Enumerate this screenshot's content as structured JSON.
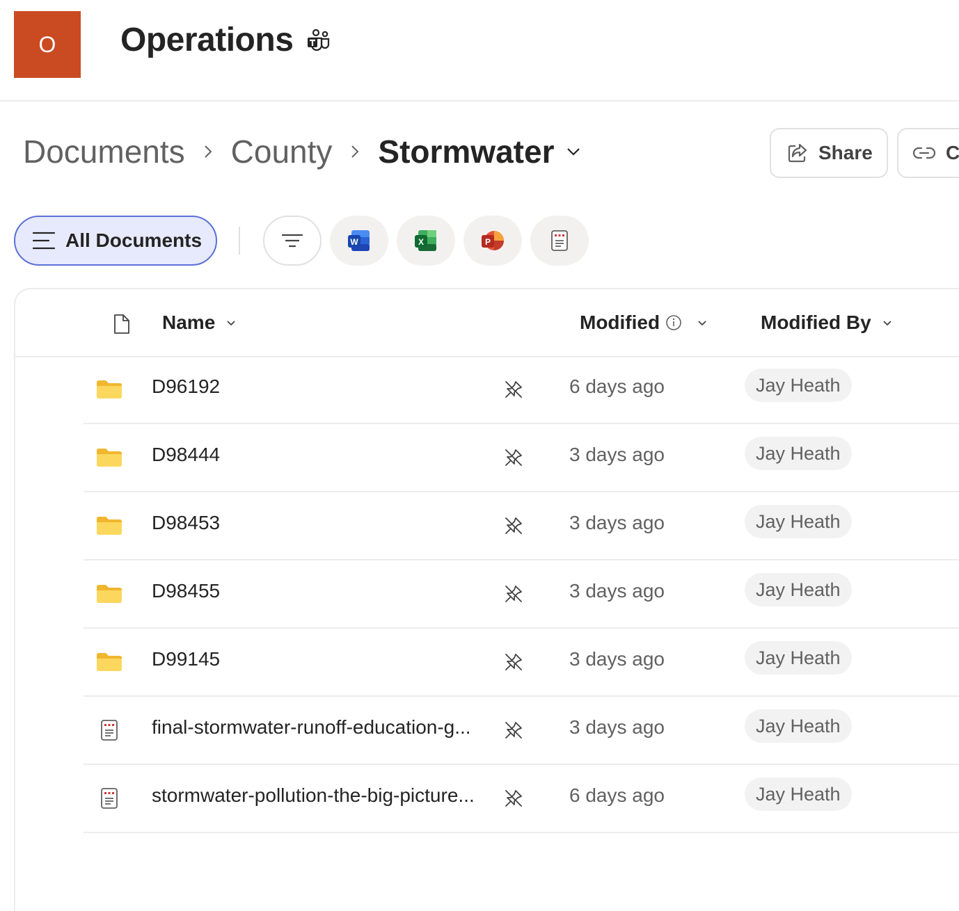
{
  "site": {
    "logo_letter": "O",
    "title": "Operations",
    "logo_color": "#ca4a22"
  },
  "breadcrumb": {
    "items": [
      "Documents",
      "County",
      "Stormwater"
    ]
  },
  "actions": {
    "share_label": "Share",
    "copy_label": "Co"
  },
  "filters": {
    "view_label": "All Documents",
    "chips": [
      "filter-icon",
      "word-icon",
      "excel-icon",
      "powerpoint-icon",
      "pdf-icon"
    ]
  },
  "list": {
    "columns": {
      "name": "Name",
      "modified": "Modified",
      "modified_by": "Modified By"
    },
    "rows": [
      {
        "type": "folder",
        "name": "D96192",
        "modified": "6 days ago",
        "modified_by": "Jay Heath"
      },
      {
        "type": "folder",
        "name": "D98444",
        "modified": "3 days ago",
        "modified_by": "Jay Heath"
      },
      {
        "type": "folder",
        "name": "D98453",
        "modified": "3 days ago",
        "modified_by": "Jay Heath"
      },
      {
        "type": "folder",
        "name": "D98455",
        "modified": "3 days ago",
        "modified_by": "Jay Heath"
      },
      {
        "type": "folder",
        "name": "D99145",
        "modified": "3 days ago",
        "modified_by": "Jay Heath"
      },
      {
        "type": "pdf",
        "name": "final-stormwater-runoff-education-g...",
        "modified": "3 days ago",
        "modified_by": "Jay Heath"
      },
      {
        "type": "pdf",
        "name": "stormwater-pollution-the-big-picture...",
        "modified": "6 days ago",
        "modified_by": "Jay Heath"
      }
    ]
  }
}
